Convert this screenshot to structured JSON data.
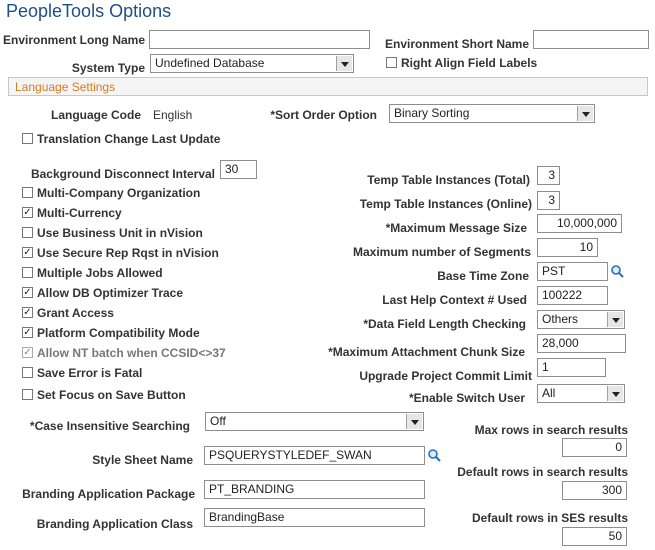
{
  "page_title": "PeopleTools Options",
  "env_long_name": {
    "label": "Environment Long Name",
    "value": ""
  },
  "env_short_name": {
    "label": "Environment Short Name",
    "value": ""
  },
  "system_type": {
    "label": "System Type",
    "value": "Undefined Database"
  },
  "right_align": {
    "label": "Right Align Field Labels",
    "checked": false
  },
  "section_language": "Language Settings",
  "language_code": {
    "label": "Language Code",
    "value": "English"
  },
  "sort_order": {
    "label": "*Sort Order Option",
    "value": "Binary Sorting"
  },
  "translation_change": {
    "label": "Translation Change Last Update",
    "checked": false
  },
  "bg_disconnect": {
    "label": "Background Disconnect Interval",
    "value": "30"
  },
  "checkboxes": {
    "multi_company": {
      "label": "Multi-Company Organization",
      "mark": ""
    },
    "multi_currency": {
      "label": "Multi-Currency",
      "mark": "✓"
    },
    "business_unit": {
      "label": "Use Business Unit in nVision",
      "mark": ""
    },
    "secure_rep": {
      "label": "Use Secure Rep Rqst in nVision",
      "mark": "✓"
    },
    "multiple_jobs": {
      "label": "Multiple Jobs Allowed",
      "mark": ""
    },
    "db_optimizer": {
      "label": "Allow DB Optimizer Trace",
      "mark": "✓"
    },
    "grant_access": {
      "label": "Grant Access",
      "mark": "✓"
    },
    "platform_compat": {
      "label": "Platform Compatibility Mode",
      "mark": "✓"
    },
    "nt_batch": {
      "label": "Allow NT batch when CCSID<>37",
      "mark": "✓"
    },
    "save_error": {
      "label": "Save Error is Fatal",
      "mark": ""
    },
    "set_focus": {
      "label": "Set Focus on Save Button",
      "mark": ""
    }
  },
  "temp_total": {
    "label": "Temp Table Instances (Total)",
    "value": "3"
  },
  "temp_online": {
    "label": "Temp Table Instances (Online)",
    "value": "3"
  },
  "max_message": {
    "label": "*Maximum Message Size",
    "value": "10,000,000"
  },
  "max_segments": {
    "label": "Maximum number of Segments",
    "value": "10"
  },
  "base_tz": {
    "label": "Base Time Zone",
    "value": "PST"
  },
  "last_help": {
    "label": "Last Help Context # Used",
    "value": "100222"
  },
  "data_field_length": {
    "label": "*Data Field Length Checking",
    "value": "Others"
  },
  "max_attach": {
    "label": "*Maximum Attachment Chunk Size",
    "value": "28,000"
  },
  "upgrade_commit": {
    "label": "Upgrade Project Commit Limit",
    "value": "1"
  },
  "switch_user": {
    "label": "*Enable Switch User",
    "value": "All"
  },
  "case_insensitive": {
    "label": "*Case Insensitive Searching",
    "value": "Off"
  },
  "style_sheet": {
    "label": "Style Sheet Name",
    "value": "PSQUERYSTYLEDEF_SWAN"
  },
  "branding_package": {
    "label": "Branding Application Package",
    "value": "PT_BRANDING"
  },
  "branding_class": {
    "label": "Branding Application Class",
    "value": "BrandingBase"
  },
  "max_rows": {
    "label": "Max rows in search results",
    "value": "0"
  },
  "default_rows": {
    "label": "Default rows in search results",
    "value": "300"
  },
  "ses_rows": {
    "label": "Default rows in SES results",
    "value": "50"
  },
  "colors": {
    "title": "#1f4e8c",
    "section_text": "#d97a1f",
    "section_bg": "#f5f5f5"
  },
  "icons": {
    "lookup": "magnifier-icon",
    "dropdown": "chevron-down-icon",
    "check": "checkmark-icon"
  }
}
